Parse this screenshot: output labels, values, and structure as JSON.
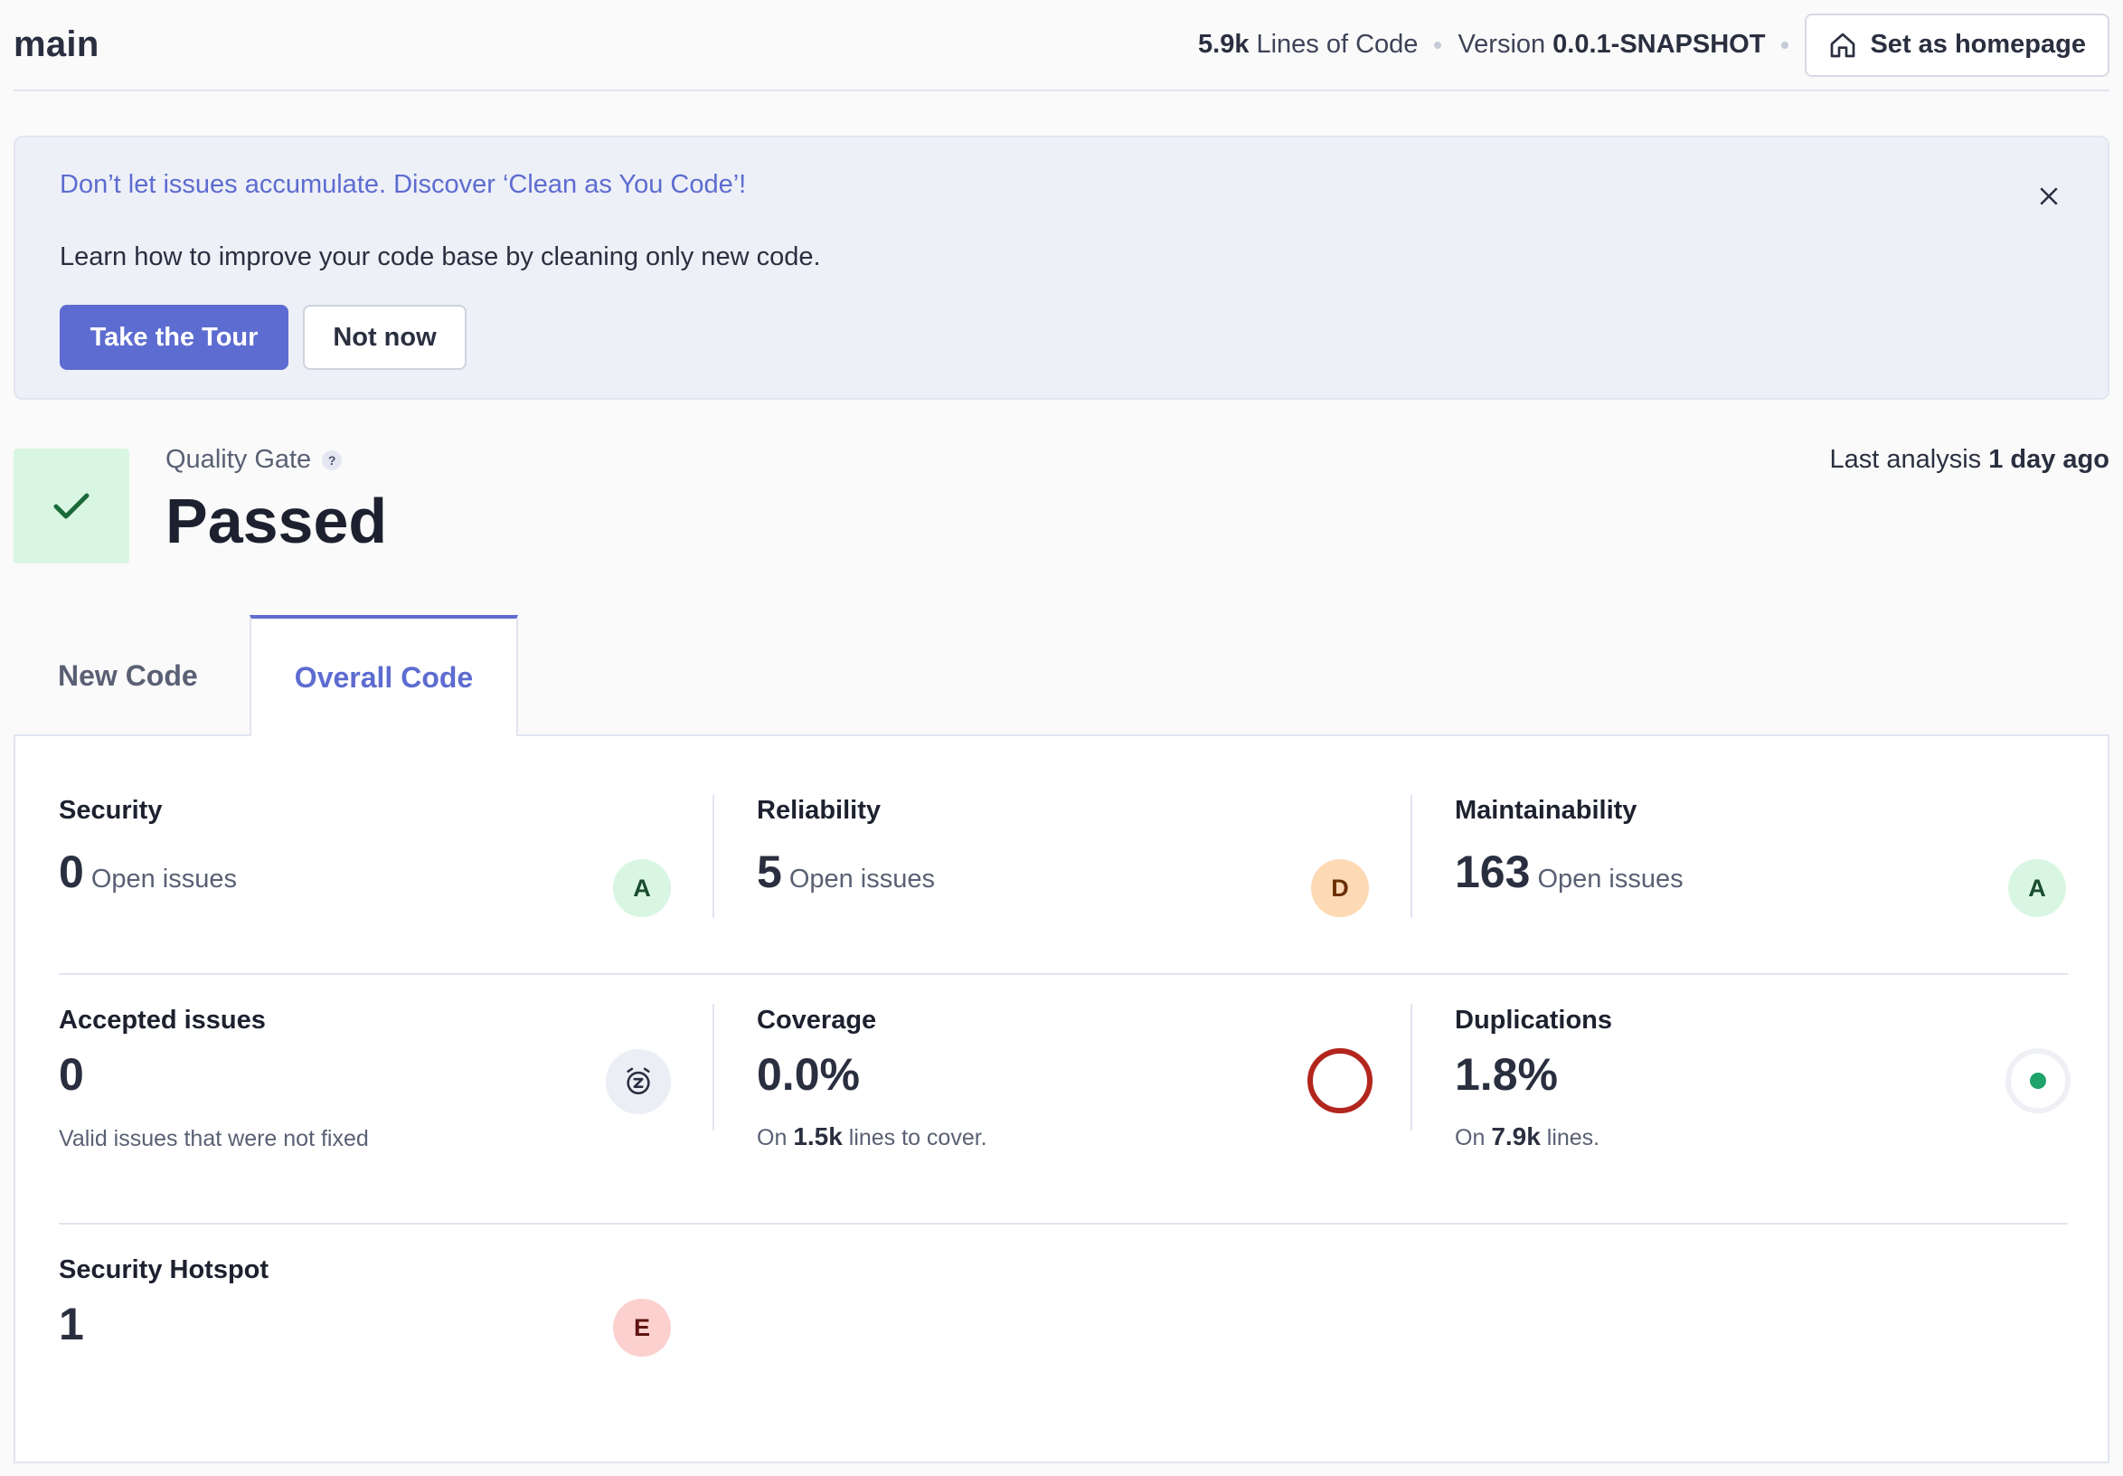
{
  "header": {
    "branch": "main",
    "lines_value": "5.9k",
    "lines_label": "Lines of Code",
    "version_label": "Version",
    "version_value": "0.0.1-SNAPSHOT",
    "homepage_button": "Set as homepage"
  },
  "banner": {
    "link": "Don’t let issues accumulate. Discover ‘Clean as You Code’!",
    "description": "Learn how to improve your code base by cleaning only new code.",
    "tour_button": "Take the Tour",
    "not_now_button": "Not now"
  },
  "quality_gate": {
    "label": "Quality Gate",
    "help": "?",
    "status": "Passed",
    "last_analysis_label": "Last analysis",
    "last_analysis_value": "1 day ago"
  },
  "tabs": {
    "new_code": "New Code",
    "overall_code": "Overall Code",
    "active": "overall_code"
  },
  "metrics": {
    "security": {
      "title": "Security",
      "value": "0",
      "suffix": "Open issues",
      "rating": "A"
    },
    "reliability": {
      "title": "Reliability",
      "value": "5",
      "suffix": "Open issues",
      "rating": "D"
    },
    "maintainability": {
      "title": "Maintainability",
      "value": "163",
      "suffix": "Open issues",
      "rating": "A"
    },
    "accepted": {
      "title": "Accepted issues",
      "value": "0",
      "note": "Valid issues that were not fixed"
    },
    "coverage": {
      "title": "Coverage",
      "value": "0.0%",
      "pre": "On",
      "amount": "1.5k",
      "post": "lines to cover."
    },
    "duplications": {
      "title": "Duplications",
      "value": "1.8%",
      "pre": "On",
      "amount": "7.9k",
      "post": "lines."
    },
    "hotspot": {
      "title": "Security Hotspot",
      "value": "1",
      "rating": "E"
    }
  },
  "colors": {
    "accent": "#5d6cd0",
    "rating_a_bg": "#d9f6e2",
    "rating_d_bg": "#fdd9b4",
    "rating_e_bg": "#fbd0ce",
    "coverage_ring": "#b3261e",
    "duplication_dot": "#1fa36a"
  },
  "icons": {
    "home": "home-icon",
    "close": "close-icon",
    "check": "check-icon",
    "alarm": "snooze-alarm-icon"
  }
}
